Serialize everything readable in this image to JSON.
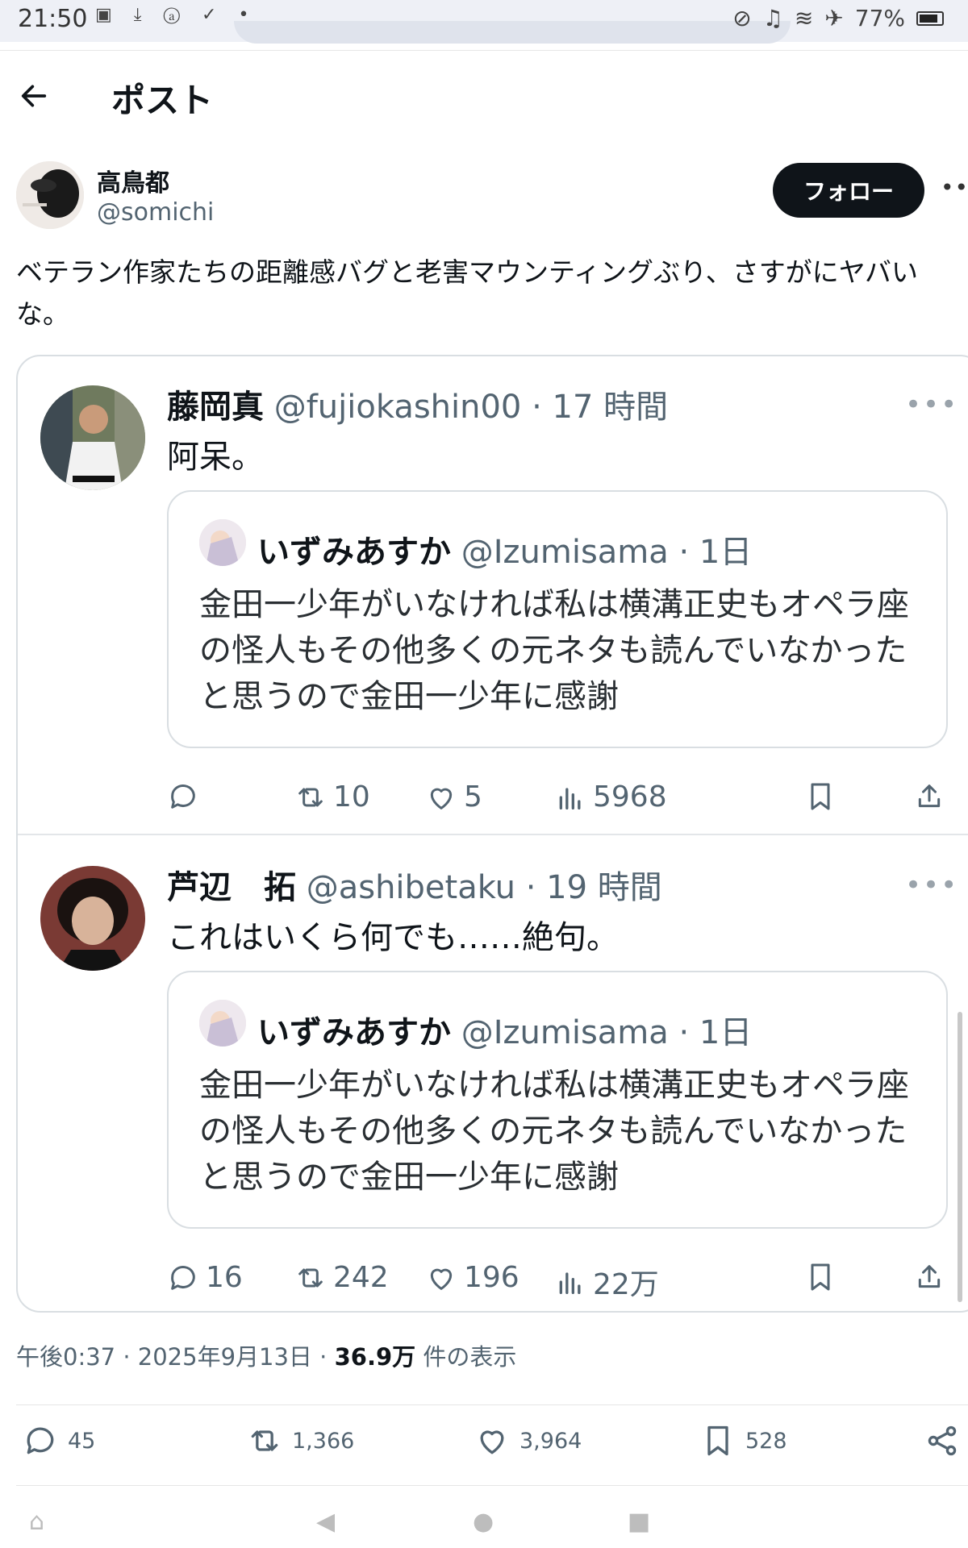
{
  "status_bar": {
    "time": "21:50",
    "battery": "77%"
  },
  "header": {
    "title": "ポスト"
  },
  "post": {
    "author_name": "高鳥都",
    "author_handle": "@somichi",
    "follow_label": "フォロー",
    "text": "ベテラン作家たちの距離感バグと老害マウンティングぶり、さすがにヤバいな。",
    "timestamp": "午後0:37 · 2025年9月13日 · ",
    "views_count": "36.9万",
    "views_label": " 件の表示",
    "stats": {
      "replies": "45",
      "reposts": "1,366",
      "likes": "3,964",
      "bookmarks": "528"
    }
  },
  "replies": [
    {
      "name": "藤岡真",
      "handle": "@fujiokashin00",
      "time": "· 17 時間",
      "text": "阿呆。",
      "quote": {
        "name": "いずみあすか",
        "handle": "@Izumisama",
        "time": "· 1日",
        "text": "金田一少年がいなければ私は横溝正史もオペラ座の怪人もその他多くの元ネタも読んでいなかったと思うので金田一少年に感謝"
      },
      "stats": {
        "replies": "",
        "reposts": "10",
        "likes": "5",
        "views": "5968"
      }
    },
    {
      "name": "芦辺　拓",
      "handle": "@ashibetaku",
      "time": "· 19 時間",
      "text": "これはいくら何でも……絶句。",
      "quote": {
        "name": "いずみあすか",
        "handle": "@Izumisama",
        "time": "· 1日",
        "text": "金田一少年がいなければ私は横溝正史もオペラ座の怪人もその他多くの元ネタも読んでいなかったと思うので金田一少年に感謝"
      },
      "stats": {
        "replies": "16",
        "reposts": "242",
        "likes": "196",
        "views": "22万"
      }
    }
  ]
}
